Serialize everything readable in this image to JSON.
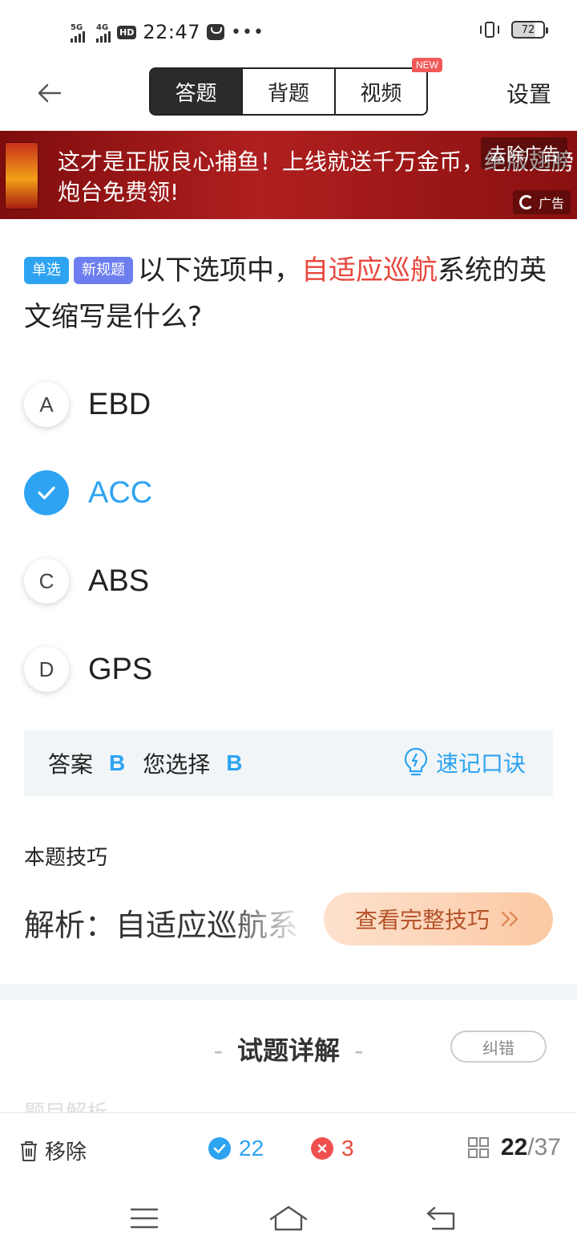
{
  "status_bar": {
    "net1": "5G",
    "net2": "4G",
    "hd": "HD",
    "time": "22:47",
    "battery": "72"
  },
  "header": {
    "tabs": [
      {
        "label": "答题",
        "active": true
      },
      {
        "label": "背题",
        "active": false
      },
      {
        "label": "视频",
        "active": false
      }
    ],
    "new_badge": "NEW",
    "settings_label": "设置"
  },
  "ad": {
    "text": "这才是正版良心捕鱼！上线就送千万金币，绝版翅膀炮台免费领!",
    "remove_label": "去除广告",
    "tag_label": "广告"
  },
  "question": {
    "type_tag": "单选",
    "rule_tag": "新规题",
    "text_before": "以下选项中，",
    "highlight": "自适应巡航",
    "text_after": "系统的英文缩写是什么?"
  },
  "options": [
    {
      "letter": "A",
      "text": "EBD",
      "selected": false
    },
    {
      "letter": "B",
      "text": "ACC",
      "selected": true
    },
    {
      "letter": "C",
      "text": "ABS",
      "selected": false
    },
    {
      "letter": "D",
      "text": "GPS",
      "selected": false
    }
  ],
  "answer": {
    "answer_label": "答案",
    "answer_value": "B",
    "choice_label": "您选择",
    "choice_value": "B",
    "tip_link": "速记口诀"
  },
  "skill": {
    "title": "本题技巧",
    "analysis_label": "解析：",
    "analysis_text": "自适应巡航系",
    "full_button": "查看完整技巧"
  },
  "detail": {
    "title": "试题详解",
    "correct_button": "纠错",
    "ghost_text": "题目解析"
  },
  "bottom_bar": {
    "remove_label": "移除",
    "correct_count": "22",
    "wrong_count": "3",
    "current": "22",
    "total": "/37"
  },
  "colors": {
    "accent": "#2ea3f2",
    "highlight": "#e8473e",
    "ad_bg": "#a01818"
  }
}
